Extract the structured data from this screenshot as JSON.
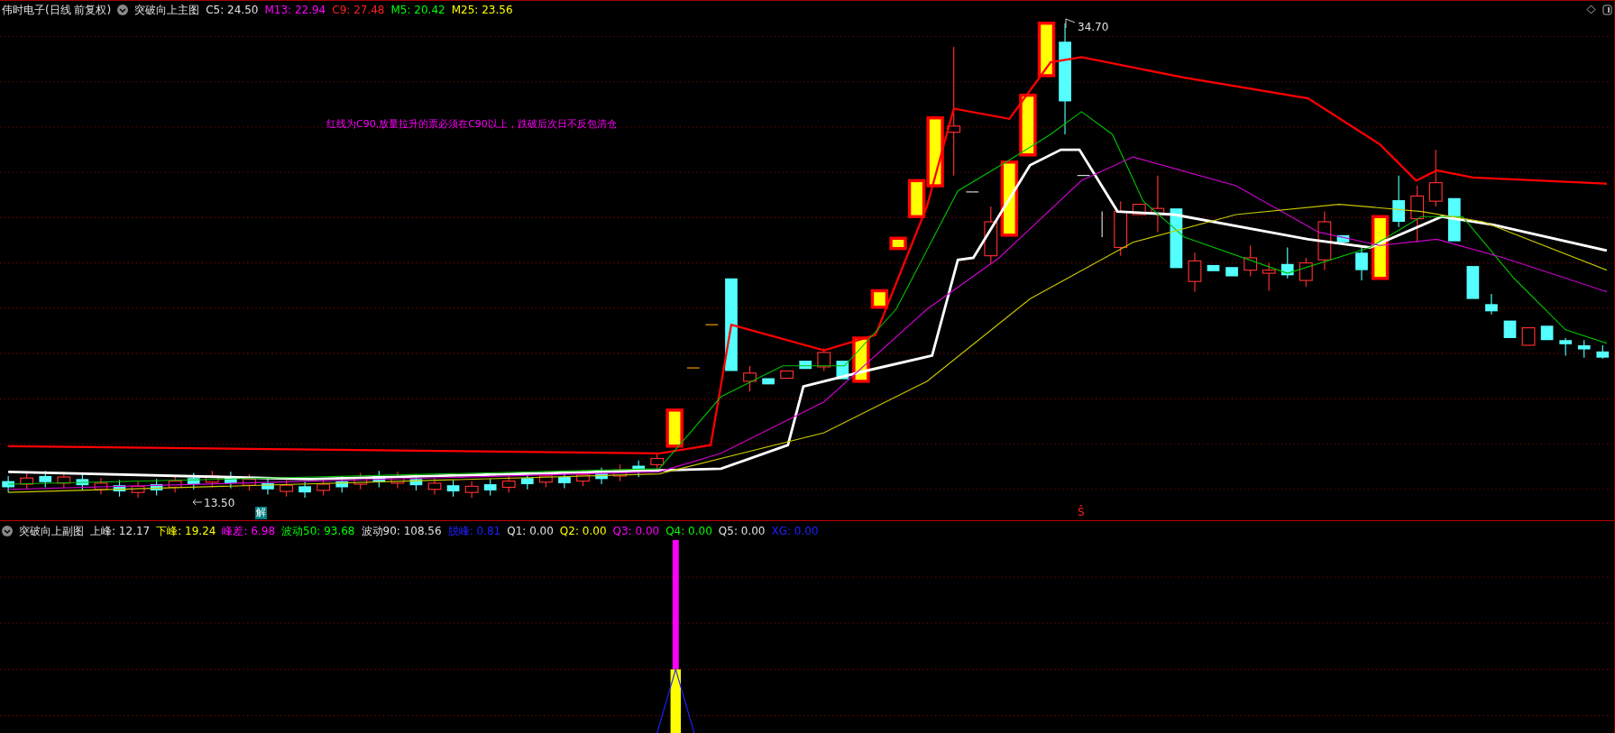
{
  "main_panel": {
    "title": "伟时电子(日线 前复权)",
    "indicator_name": "突破向上主图",
    "values": [
      {
        "text": "C5: 24.50",
        "color": "#e0e0e0"
      },
      {
        "text": "M13: 22.94",
        "color": "#ff00ff"
      },
      {
        "text": "C9: 27.48",
        "color": "#ff2020"
      },
      {
        "text": "M5: 20.42",
        "color": "#00ff00"
      },
      {
        "text": "M25: 23.56",
        "color": "#ffff00"
      }
    ],
    "annotation": "红线为C90,放量拉升的票必须在C90以上，跌破后次日不反包清仓",
    "high_label": "34.70",
    "low_label": "13.50",
    "jie_marker": "解",
    "signal_marker": "Ŝ"
  },
  "sub_panel": {
    "indicator_name": "突破向上副图",
    "values": [
      {
        "text": "上峰: 12.17",
        "color": "#e0e0e0"
      },
      {
        "text": "下峰: 19.24",
        "color": "#ffff00"
      },
      {
        "text": "峰差: 6.98",
        "color": "#ff00ff"
      },
      {
        "text": "波动50: 93.68",
        "color": "#00ff00"
      },
      {
        "text": "波动90: 108.56",
        "color": "#e0e0e0"
      },
      {
        "text": "脱峰: 0.81",
        "color": "#2020ff"
      },
      {
        "text": "Q1: 0.00",
        "color": "#e0e0e0"
      },
      {
        "text": "Q2: 0.00",
        "color": "#ffff00"
      },
      {
        "text": "Q3: 0.00",
        "color": "#ff00ff"
      },
      {
        "text": "Q4: 0.00",
        "color": "#00ff00"
      },
      {
        "text": "Q5: 0.00",
        "color": "#e0e0e0"
      },
      {
        "text": "XG: 0.00",
        "color": "#2020ff"
      }
    ]
  }
}
